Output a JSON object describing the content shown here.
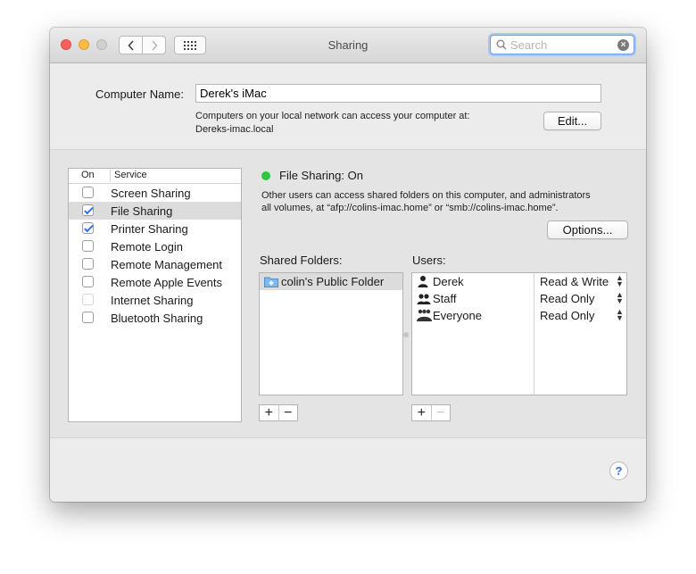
{
  "window": {
    "title": "Sharing"
  },
  "search": {
    "placeholder": "Search"
  },
  "computer": {
    "label": "Computer Name:",
    "value": "Derek's iMac",
    "desc_line1": "Computers on your local network can access your computer at:",
    "desc_line2": "Dereks-imac.local",
    "edit_label": "Edit..."
  },
  "services": {
    "header_on": "On",
    "header_service": "Service",
    "items": [
      {
        "label": "Screen Sharing",
        "checked": false
      },
      {
        "label": "File Sharing",
        "checked": true,
        "selected": true
      },
      {
        "label": "Printer Sharing",
        "checked": true
      },
      {
        "label": "Remote Login",
        "checked": false
      },
      {
        "label": "Remote Management",
        "checked": false
      },
      {
        "label": "Remote Apple Events",
        "checked": false
      },
      {
        "label": "Internet Sharing",
        "checked": false,
        "disabled": true
      },
      {
        "label": "Bluetooth Sharing",
        "checked": false
      }
    ]
  },
  "status": {
    "title": "File Sharing: On",
    "color": "#2ec840",
    "desc_line1": "Other users can access shared folders on this computer, and administrators",
    "desc_line2": "all volumes, at “afp://colins-imac.home” or “smb://colins-imac.home”."
  },
  "options_label": "Options...",
  "shared_folders": {
    "label": "Shared Folders:",
    "items": [
      "colin's Public Folder"
    ]
  },
  "users": {
    "label": "Users:",
    "items": [
      {
        "name": "Derek",
        "permission": "Read & Write",
        "icon": "single-user-icon"
      },
      {
        "name": "Staff",
        "permission": "Read Only",
        "icon": "group-icon"
      },
      {
        "name": "Everyone",
        "permission": "Read Only",
        "icon": "everyone-icon"
      }
    ]
  },
  "buttons": {
    "plus": "+",
    "minus": "−"
  },
  "help_label": "?"
}
